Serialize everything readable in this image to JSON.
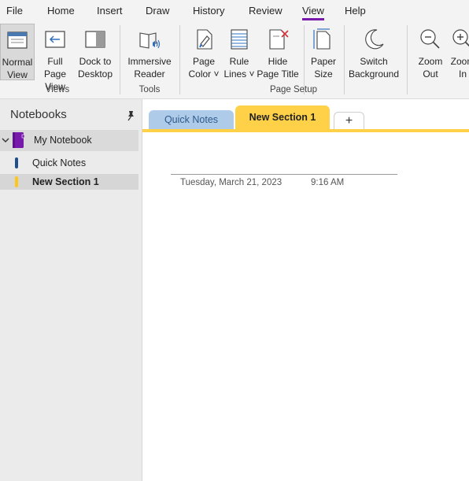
{
  "menu": {
    "tabs": [
      {
        "label": "File"
      },
      {
        "label": "Home"
      },
      {
        "label": "Insert"
      },
      {
        "label": "Draw"
      },
      {
        "label": "History"
      },
      {
        "label": "Review"
      },
      {
        "label": "View",
        "active": true
      },
      {
        "label": "Help"
      }
    ]
  },
  "ribbon": {
    "buttons": {
      "normal_view": "Normal\nView",
      "full_page_view": "Full Page\nView",
      "dock_to_desktop": "Dock to\nDesktop",
      "immersive_reader": "Immersive\nReader",
      "page_color": "Page\nColor ˅",
      "rule_lines": "Rule\nLines ˅",
      "hide_page_title": "Hide\nPage Title",
      "paper_size": "Paper\nSize",
      "switch_background": "Switch\nBackground",
      "zoom_out": "Zoom\nOut",
      "zoom_in": "Zoom\nIn"
    },
    "groups": {
      "views": "Views",
      "tools": "Tools",
      "page_setup": "Page Setup"
    }
  },
  "sidebar": {
    "title": "Notebooks",
    "notebook": {
      "name": "My Notebook",
      "color": "#7719aa"
    },
    "sections": [
      {
        "label": "Quick Notes",
        "color": "#1f4e8c"
      },
      {
        "label": "New Section 1",
        "color": "#ffc61a"
      }
    ]
  },
  "section_tabs": {
    "tabs": [
      {
        "label": "Quick Notes",
        "color": "#aecbea"
      },
      {
        "label": "New Section 1",
        "color": "#ffd149",
        "active": true
      }
    ],
    "add_label": "+"
  },
  "page": {
    "date": "Tuesday, March 21, 2023",
    "time": "9:16 AM"
  },
  "colors": {
    "accent": "#7719aa",
    "section_yellow": "#ffd149"
  }
}
